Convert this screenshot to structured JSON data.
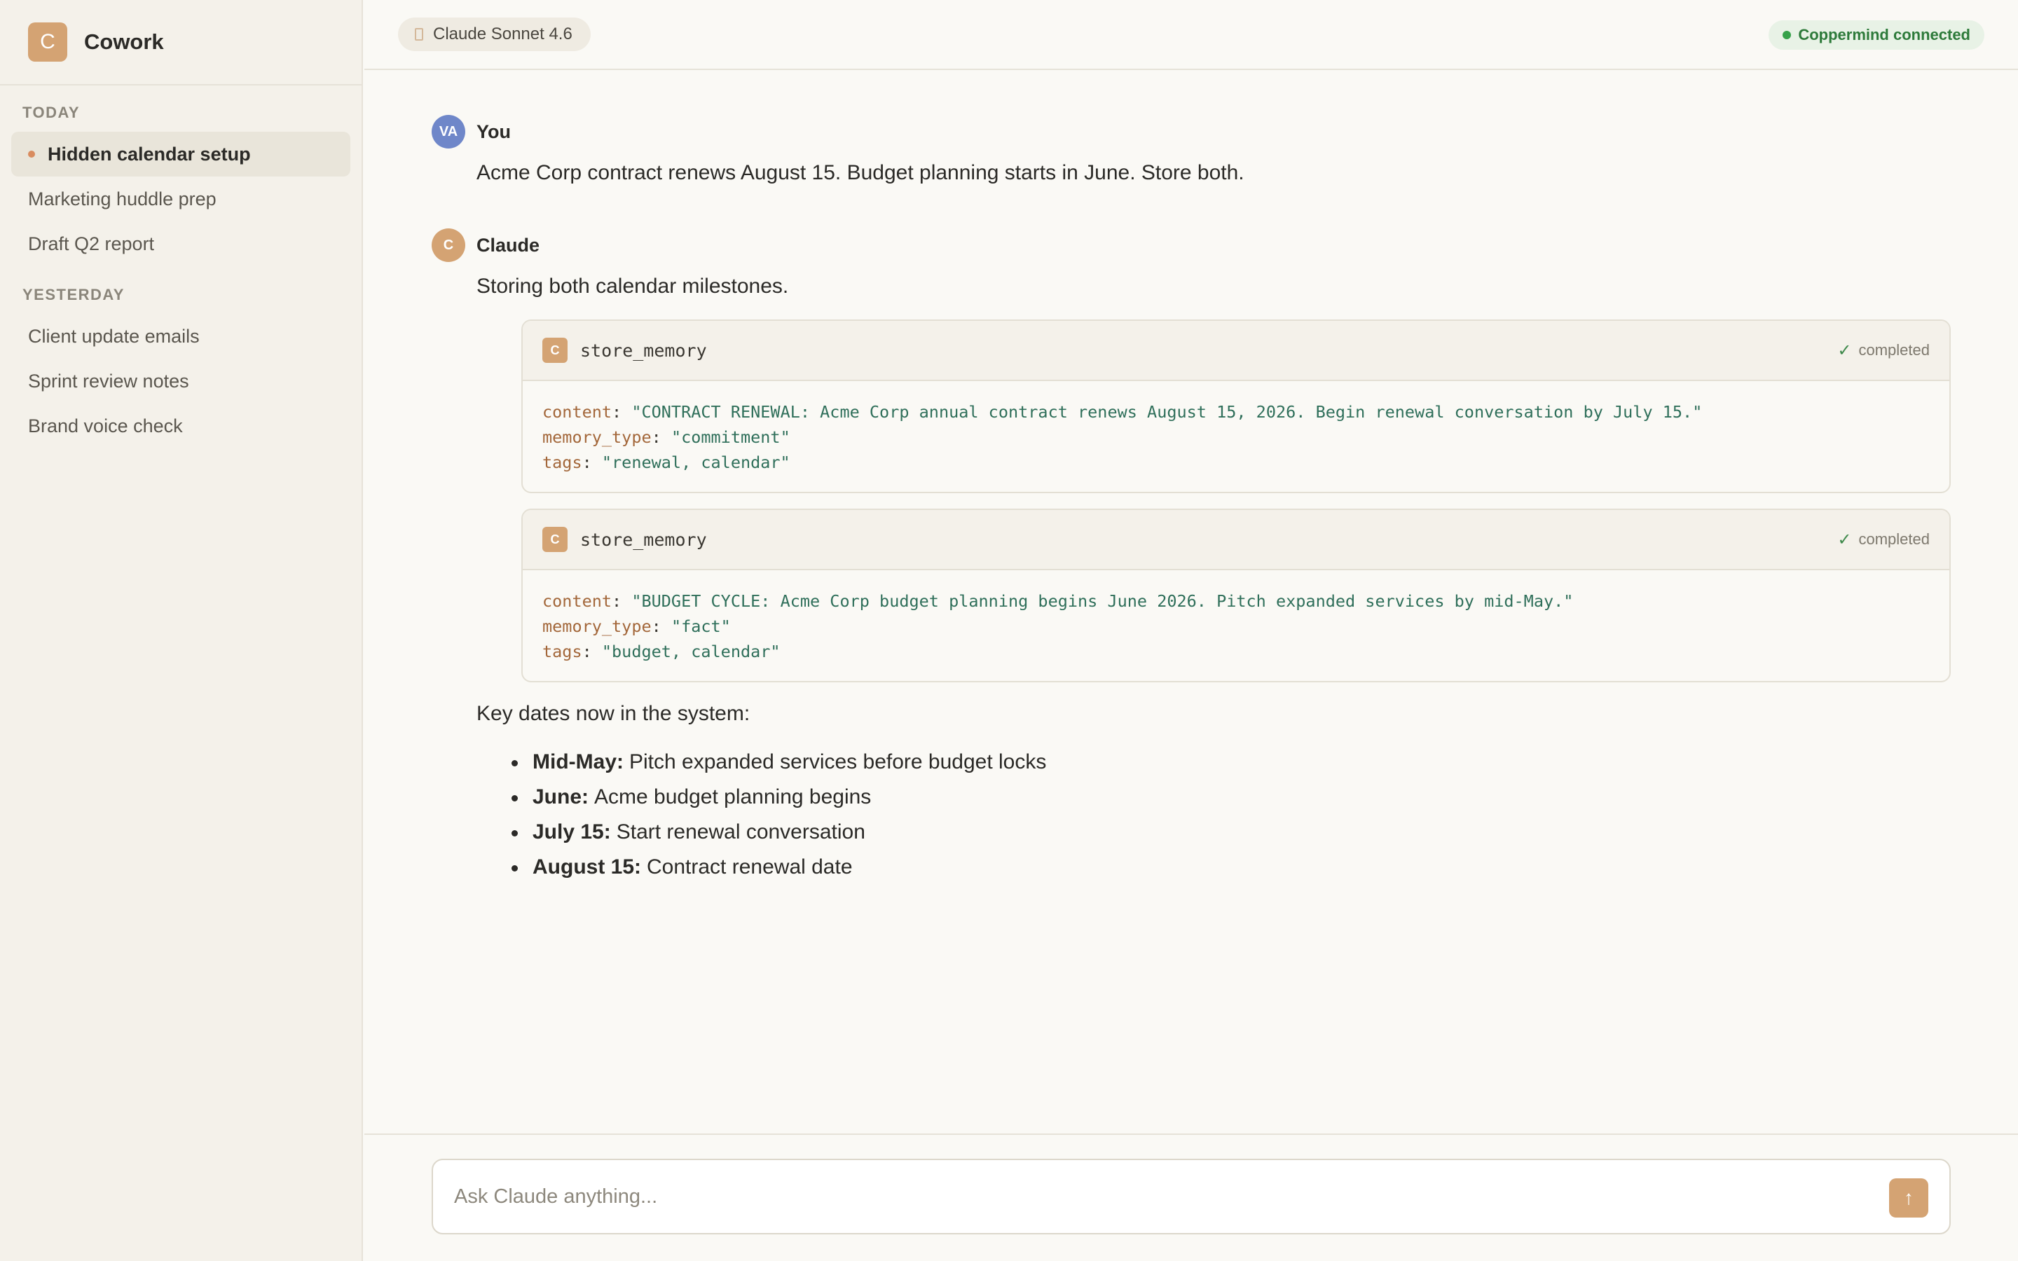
{
  "app": {
    "name": "Cowork",
    "logo_letter": "C"
  },
  "sidebar": {
    "today_label": "TODAY",
    "yesterday_label": "YESTERDAY",
    "today_items": [
      {
        "label": "Hidden calendar setup",
        "active": true
      },
      {
        "label": "Marketing huddle prep"
      },
      {
        "label": "Draft Q2 report"
      }
    ],
    "yesterday_items": [
      {
        "label": "Client update emails"
      },
      {
        "label": "Sprint review notes"
      },
      {
        "label": "Brand voice check"
      }
    ]
  },
  "header": {
    "model": "Claude Sonnet 4.6",
    "connection": "Coppermind connected"
  },
  "conversation": {
    "user": {
      "avatar": "VA",
      "name": "You",
      "text": "Acme Corp contract renews August 15. Budget planning starts in June. Store both."
    },
    "assistant": {
      "avatar": "C",
      "name": "Claude",
      "intro": "Storing both calendar milestones.",
      "tools": [
        {
          "icon": "C",
          "name": "store_memory",
          "status": "completed",
          "params": [
            {
              "key": "content",
              "value": "\"CONTRACT RENEWAL: Acme Corp annual contract renews August 15, 2026. Begin renewal conversation by July 15.\""
            },
            {
              "key": "memory_type",
              "value": "\"commitment\""
            },
            {
              "key": "tags",
              "value": "\"renewal, calendar\""
            }
          ]
        },
        {
          "icon": "C",
          "name": "store_memory",
          "status": "completed",
          "params": [
            {
              "key": "content",
              "value": "\"BUDGET CYCLE: Acme Corp budget planning begins June 2026. Pitch expanded services by mid-May.\""
            },
            {
              "key": "memory_type",
              "value": "\"fact\""
            },
            {
              "key": "tags",
              "value": "\"budget, calendar\""
            }
          ]
        }
      ],
      "summary": "Key dates now in the system:",
      "bullets": [
        {
          "label": "Mid-May:",
          "text": "Pitch expanded services before budget locks"
        },
        {
          "label": "June:",
          "text": "Acme budget planning begins"
        },
        {
          "label": "July 15:",
          "text": "Start renewal conversation"
        },
        {
          "label": "August 15:",
          "text": "Contract renewal date"
        }
      ]
    }
  },
  "composer": {
    "placeholder": "Ask Claude anything...",
    "send_icon": "arrow-up-icon"
  },
  "colors": {
    "accent": "#d4a373",
    "user_avatar": "#6f87c9",
    "connected": "#36a24a"
  }
}
